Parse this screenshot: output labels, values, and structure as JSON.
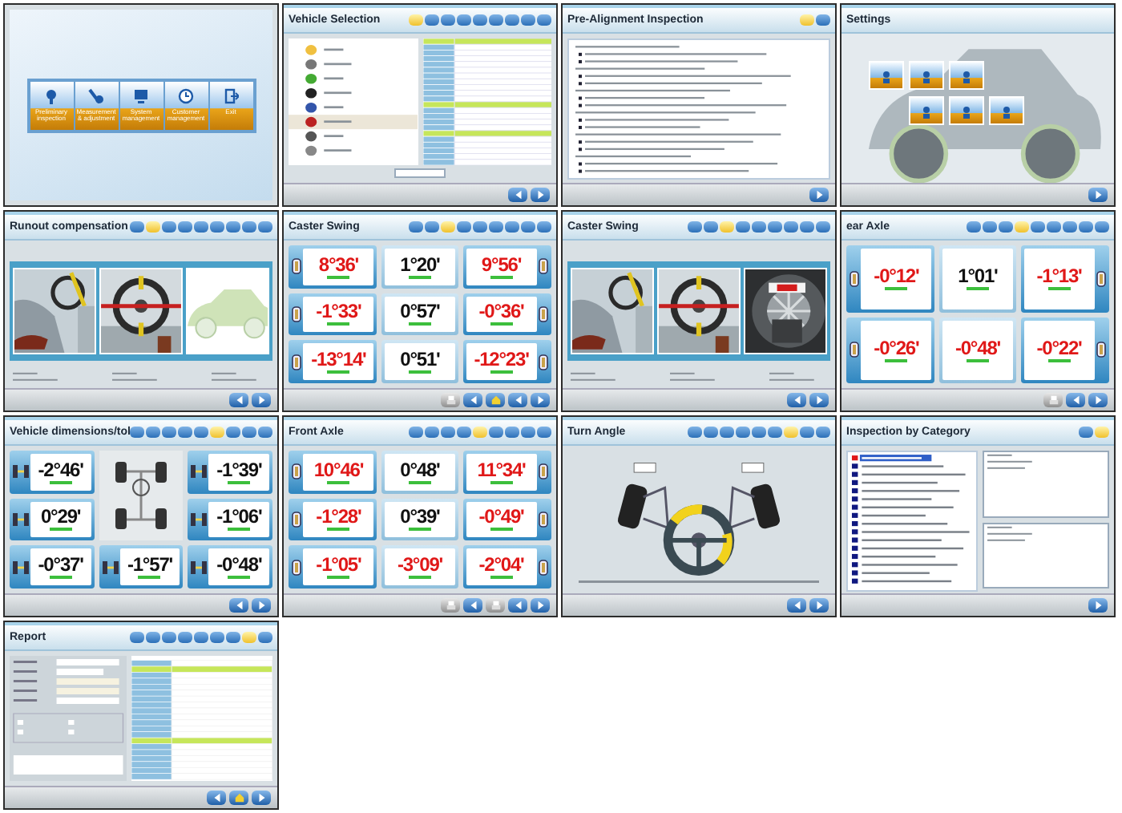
{
  "panels": [
    {
      "kind": "menu",
      "items": [
        {
          "label": "Preliminary inspection"
        },
        {
          "label": "Measurement & adjustment"
        },
        {
          "label": "System management"
        },
        {
          "label": "Customer management"
        },
        {
          "label": "Exit"
        }
      ]
    },
    {
      "kind": "vehicle",
      "title": "Vehicle Selection",
      "toolbar": [
        {
          "selected": true
        },
        {
          "selected": false
        },
        {
          "selected": false
        },
        {
          "selected": false
        },
        {
          "selected": false
        },
        {
          "selected": false
        },
        {
          "selected": false
        },
        {
          "selected": false
        },
        {
          "selected": false
        }
      ],
      "footer": [
        {
          "kind": "back"
        },
        {
          "kind": "next"
        }
      ]
    },
    {
      "kind": "checklist",
      "title": "Pre-Alignment Inspection",
      "toolbar": [
        {
          "selected": true
        },
        {
          "selected": false
        }
      ],
      "footer": [
        {
          "kind": "next"
        }
      ]
    },
    {
      "kind": "settings",
      "title": "Settings",
      "footer": [
        {
          "kind": "next"
        }
      ]
    },
    {
      "kind": "steps",
      "title": "Runout compensation",
      "toolbar": [
        {
          "selected": false
        },
        {
          "selected": true
        },
        {
          "selected": false
        },
        {
          "selected": false
        },
        {
          "selected": false
        },
        {
          "selected": false
        },
        {
          "selected": false
        },
        {
          "selected": false
        },
        {
          "selected": false
        }
      ],
      "frames": [
        {
          "kind": "picture"
        },
        {
          "kind": "picture"
        },
        {
          "kind": "picture"
        }
      ],
      "footer": [
        {
          "kind": "back"
        },
        {
          "kind": "next"
        }
      ]
    },
    {
      "kind": "readings",
      "title": "Caster Swing",
      "toolbar": [
        {
          "selected": false
        },
        {
          "selected": false
        },
        {
          "selected": true
        },
        {
          "selected": false
        },
        {
          "selected": false
        },
        {
          "selected": false
        },
        {
          "selected": false
        },
        {
          "selected": false
        },
        {
          "selected": false
        }
      ],
      "readings": [
        {
          "value": "8°36'",
          "out_of_range": true
        },
        {
          "value": "1°20'",
          "out_of_range": false
        },
        {
          "value": "9°56'",
          "out_of_range": true
        },
        {
          "value": "-1°33'",
          "out_of_range": true
        },
        {
          "value": "0°57'",
          "out_of_range": false
        },
        {
          "value": "-0°36'",
          "out_of_range": true
        },
        {
          "value": "-13°14'",
          "out_of_range": true
        },
        {
          "value": "0°51'",
          "out_of_range": false
        },
        {
          "value": "-12°23'",
          "out_of_range": true
        }
      ],
      "footer": [
        {
          "kind": "print"
        },
        {
          "kind": "back"
        },
        {
          "kind": "home"
        },
        {
          "kind": "back"
        },
        {
          "kind": "next"
        }
      ]
    },
    {
      "kind": "steps",
      "title": "Caster Swing",
      "toolbar": [
        {
          "selected": false
        },
        {
          "selected": false
        },
        {
          "selected": true
        },
        {
          "selected": false
        },
        {
          "selected": false
        },
        {
          "selected": false
        },
        {
          "selected": false
        },
        {
          "selected": false
        },
        {
          "selected": false
        }
      ],
      "frames": [
        {
          "kind": "picture"
        },
        {
          "kind": "picture"
        },
        {
          "kind": "picture"
        }
      ],
      "footer": [
        {
          "kind": "back"
        },
        {
          "kind": "next"
        }
      ]
    },
    {
      "kind": "readings",
      "title": "ear Axle",
      "toolbar": [
        {
          "selected": false
        },
        {
          "selected": false
        },
        {
          "selected": false
        },
        {
          "selected": true
        },
        {
          "selected": false
        },
        {
          "selected": false
        },
        {
          "selected": false
        },
        {
          "selected": false
        },
        {
          "selected": false
        }
      ],
      "readings": [
        {
          "value": "-0°12'",
          "out_of_range": true
        },
        {
          "value": "1°01'",
          "out_of_range": false
        },
        {
          "value": "-1°13'",
          "out_of_range": true
        },
        {
          "value": "-0°26'",
          "out_of_range": true
        },
        {
          "value": "-0°48'",
          "out_of_range": true
        },
        {
          "value": "-0°22'",
          "out_of_range": true
        }
      ],
      "footer": [
        {
          "kind": "print"
        },
        {
          "kind": "back"
        },
        {
          "kind": "next"
        }
      ]
    },
    {
      "kind": "dimensions",
      "title": "Vehicle dimensions/tol",
      "toolbar": [
        {
          "selected": false
        },
        {
          "selected": false
        },
        {
          "selected": false
        },
        {
          "selected": false
        },
        {
          "selected": false
        },
        {
          "selected": true
        },
        {
          "selected": false
        },
        {
          "selected": false
        },
        {
          "selected": false
        }
      ],
      "readings": [
        {
          "value": "-2°46'",
          "out_of_range": false
        },
        {
          "value": "-1°39'",
          "out_of_range": false
        },
        {
          "value": "0°29'",
          "out_of_range": false
        },
        {
          "value": "-1°06'",
          "out_of_range": false
        },
        {
          "value": "-0°37'",
          "out_of_range": false
        },
        {
          "value": "-1°57'",
          "out_of_range": false
        },
        {
          "value": "-0°48'",
          "out_of_range": false
        }
      ],
      "footer": [
        {
          "kind": "back"
        },
        {
          "kind": "next"
        }
      ]
    },
    {
      "kind": "readings",
      "title": "Front Axle",
      "toolbar": [
        {
          "selected": false
        },
        {
          "selected": false
        },
        {
          "selected": false
        },
        {
          "selected": false
        },
        {
          "selected": true
        },
        {
          "selected": false
        },
        {
          "selected": false
        },
        {
          "selected": false
        },
        {
          "selected": false
        }
      ],
      "readings": [
        {
          "value": "10°46'",
          "out_of_range": true
        },
        {
          "value": "0°48'",
          "out_of_range": false
        },
        {
          "value": "11°34'",
          "out_of_range": true
        },
        {
          "value": "-1°28'",
          "out_of_range": true
        },
        {
          "value": "0°39'",
          "out_of_range": false
        },
        {
          "value": "-0°49'",
          "out_of_range": true
        },
        {
          "value": "-1°05'",
          "out_of_range": true
        },
        {
          "value": "-3°09'",
          "out_of_range": true
        },
        {
          "value": "-2°04'",
          "out_of_range": true
        }
      ],
      "footer": [
        {
          "kind": "print"
        },
        {
          "kind": "back"
        },
        {
          "kind": "print"
        },
        {
          "kind": "back"
        },
        {
          "kind": "next"
        }
      ]
    },
    {
      "kind": "turn",
      "title": "Turn Angle",
      "toolbar": [
        {
          "selected": false
        },
        {
          "selected": false
        },
        {
          "selected": false
        },
        {
          "selected": false
        },
        {
          "selected": false
        },
        {
          "selected": false
        },
        {
          "selected": true
        },
        {
          "selected": false
        },
        {
          "selected": false
        }
      ],
      "footer": [
        {
          "kind": "back"
        },
        {
          "kind": "next"
        }
      ]
    },
    {
      "kind": "category",
      "title": "Inspection by Category",
      "toolbar": [
        {
          "selected": false
        },
        {
          "selected": true
        }
      ],
      "footer": [
        {
          "kind": "next"
        }
      ]
    },
    {
      "kind": "report",
      "title": "Report",
      "toolbar": [
        {
          "selected": false
        },
        {
          "selected": false
        },
        {
          "selected": false
        },
        {
          "selected": false
        },
        {
          "selected": false
        },
        {
          "selected": false
        },
        {
          "selected": false
        },
        {
          "selected": true
        },
        {
          "selected": false
        }
      ],
      "footer": [
        {
          "kind": "back"
        },
        {
          "kind": "home"
        },
        {
          "kind": "next"
        }
      ]
    }
  ]
}
